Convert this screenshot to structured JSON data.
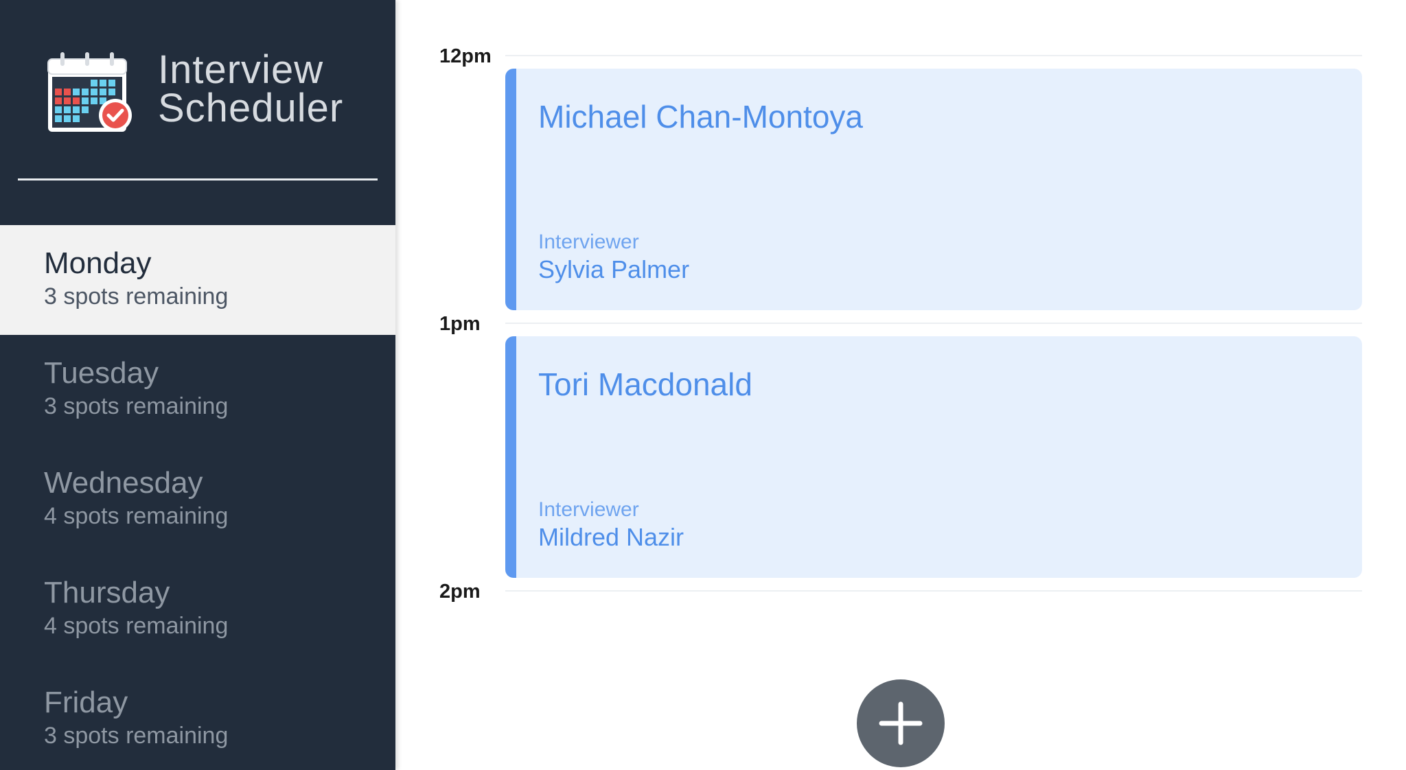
{
  "sidebar": {
    "brand": {
      "title": "Interview\nScheduler",
      "logo_icon": "calendar-check-icon"
    },
    "days": [
      {
        "name": "Monday",
        "spots": "3 spots remaining",
        "selected": true
      },
      {
        "name": "Tuesday",
        "spots": "3 spots remaining",
        "selected": false
      },
      {
        "name": "Wednesday",
        "spots": "4 spots remaining",
        "selected": false
      },
      {
        "name": "Thursday",
        "spots": "4 spots remaining",
        "selected": false
      },
      {
        "name": "Friday",
        "spots": "3 spots remaining",
        "selected": false
      }
    ]
  },
  "schedule": {
    "times": [
      "12pm",
      "1pm",
      "2pm"
    ],
    "appointments": [
      {
        "student": "Michael Chan-Montoya",
        "interviewer_label": "Interviewer",
        "interviewer": "Sylvia Palmer"
      },
      {
        "student": "Tori Macdonald",
        "interviewer_label": "Interviewer",
        "interviewer": "Mildred Nazir"
      }
    ],
    "add_button_icon": "plus-icon"
  },
  "colors": {
    "sidebar_bg": "#222d3c",
    "selected_day_bg": "#f2f2f2",
    "appointment_bg": "#e6f0fd",
    "appointment_accent": "#5e99f0",
    "add_button_bg": "#5d656e"
  }
}
